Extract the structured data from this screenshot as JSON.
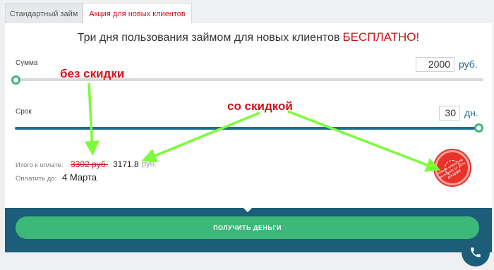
{
  "tabs": {
    "standard": "Стандартный займ",
    "promo": "Акция для новых клиентов"
  },
  "headline": {
    "text": "Три дня пользования займом для новых клиентов",
    "highlight": "БЕСПЛАТНО!"
  },
  "sum": {
    "label": "Сумма",
    "value": "2000",
    "unit": "руб.",
    "slider_fraction": 0
  },
  "term": {
    "label": "Срок",
    "value": "30",
    "unit": "дн.",
    "slider_fraction": 1
  },
  "total": {
    "label": "Итого к оплате:",
    "old_price": "3302 руб.",
    "new_price": "3171.8",
    "unit": "руб."
  },
  "payment": {
    "label": "Оплатить до:",
    "date": "4 Марта"
  },
  "stamp": {
    "text": "новым клиентам экономия от 10% до 100%"
  },
  "cta": {
    "label": "ПОЛУЧИТЬ ДЕНЬГИ"
  },
  "annotations": {
    "no_discount": "без скидки",
    "with_discount": "со скидкой"
  },
  "colors": {
    "accent_red": "#d0121b",
    "green": "#3cb878",
    "footer_blue": "#1c5d7a",
    "arrow_green": "#7cfc3a"
  },
  "icons": {
    "phone": "phone-icon"
  }
}
